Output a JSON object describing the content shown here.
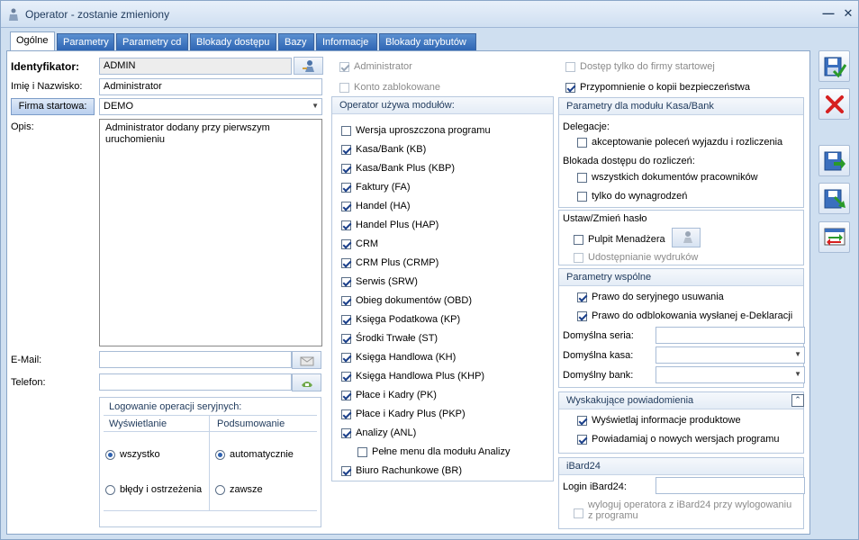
{
  "window": {
    "title": "Operator - zostanie zmieniony",
    "minimize": "—",
    "close": "✕"
  },
  "tabs": [
    "Ogólne",
    "Parametry",
    "Parametry cd",
    "Blokady dostępu",
    "Bazy",
    "Informacje",
    "Blokady atrybutów"
  ],
  "left": {
    "identyfikator_label": "Identyfikator:",
    "identyfikator_value": "ADMIN",
    "imie_label": "Imię i Nazwisko:",
    "imie_value": "Administrator",
    "firma_button": "Firma startowa:",
    "firma_value": "DEMO",
    "opis_label": "Opis:",
    "opis_value": "Administrator dodany przy pierwszym uruchomieniu",
    "email_label": "E-Mail:",
    "email_value": "",
    "telefon_label": "Telefon:",
    "telefon_value": "",
    "log_title": "Logowanie operacji seryjnych:",
    "wyswietlanie": "Wyświetlanie",
    "podsumowanie": "Podsumowanie",
    "r_wszystko": "wszystko",
    "r_bledy": "błędy i ostrzeżenia",
    "r_auto": "automatycznie",
    "r_zawsze": "zawsze"
  },
  "middle": {
    "administrator": "Administrator",
    "konto_zablokowane": "Konto zablokowane",
    "modules_title": "Operator używa modułów:",
    "modules": [
      {
        "label": "Wersja uproszczona programu",
        "checked": false
      },
      {
        "label": "Kasa/Bank (KB)",
        "checked": true
      },
      {
        "label": "Kasa/Bank Plus (KBP)",
        "checked": true
      },
      {
        "label": "Faktury (FA)",
        "checked": true
      },
      {
        "label": "Handel (HA)",
        "checked": true
      },
      {
        "label": "Handel Plus (HAP)",
        "checked": true
      },
      {
        "label": "CRM",
        "checked": true
      },
      {
        "label": "CRM Plus (CRMP)",
        "checked": true
      },
      {
        "label": "Serwis (SRW)",
        "checked": true
      },
      {
        "label": "Obieg dokumentów (OBD)",
        "checked": true
      },
      {
        "label": "Księga Podatkowa (KP)",
        "checked": true
      },
      {
        "label": "Środki Trwałe (ST)",
        "checked": true
      },
      {
        "label": "Księga Handlowa (KH)",
        "checked": true
      },
      {
        "label": "Księga Handlowa Plus (KHP)",
        "checked": true
      },
      {
        "label": "Płace i Kadry (PK)",
        "checked": true
      },
      {
        "label": "Płace i Kadry Plus (PKP)",
        "checked": true
      },
      {
        "label": "Analizy (ANL)",
        "checked": true
      },
      {
        "label": "Pełne menu dla modułu Analizy",
        "checked": false
      },
      {
        "label": "Biuro Rachunkowe (BR)",
        "checked": true
      }
    ]
  },
  "right": {
    "dostep_tylko": "Dostęp tylko do firmy startowej",
    "przypomnienie": "Przypomnienie o kopii bezpieczeństwa",
    "kasabank_title": "Parametry dla modułu Kasa/Bank",
    "delegacje": "Delegacje:",
    "akceptowanie": "akceptowanie poleceń wyjazdu i rozliczenia",
    "blokada": "Blokada dostępu do rozliczeń:",
    "wszystkich": "wszystkich dokumentów pracowników",
    "tylko_wyn": "tylko do wynagrodzeń",
    "haslo_title": "Ustaw/Zmień hasło",
    "pulpit": "Pulpit Menadżera",
    "udostepnianie": "Udostępnianie wydruków",
    "wspolne_title": "Parametry wspólne",
    "prawo_seryjne": "Prawo do seryjnego usuwania",
    "prawo_odblok": "Prawo do odblokowania wysłanej e-Deklaracji",
    "seria_label": "Domyślna seria:",
    "kasa_label": "Domyślna kasa:",
    "bank_label": "Domyślny bank:",
    "powiad_title": "Wyskakujące powiadomienia",
    "wyswietlaj": "Wyświetlaj informacje produktowe",
    "powiadamiaj": "Powiadamiaj o nowych wersjach programu",
    "ibard_title": "iBard24",
    "login_label": "Login iBard24:",
    "wyloguj": "wyloguj operatora z iBard24 przy wylogowaniu z programu"
  },
  "colors": {
    "accent": "#2f66b4",
    "panel_bg": "#ffffff",
    "window_bg": "#cfdff0"
  }
}
